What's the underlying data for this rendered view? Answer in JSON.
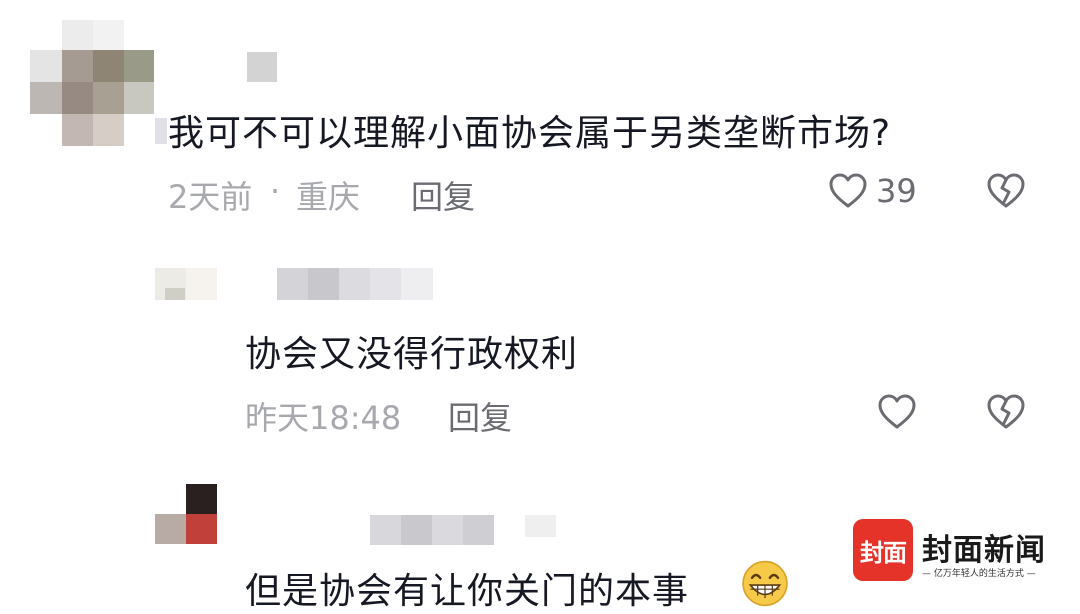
{
  "comments": [
    {
      "text": "我可不可以理解小面协会属于另类垄断市场?",
      "time": "2天前",
      "separator": "·",
      "location": "重庆",
      "reply_label": "回复",
      "like_count": "39"
    },
    {
      "text": "协会又没得行政权利",
      "time": "昨天18:48",
      "reply_label": "回复",
      "like_count": ""
    },
    {
      "text": "但是协会有让你关门的本事",
      "emoji": "grinning-face-emoji"
    }
  ],
  "watermark": {
    "badge_text": "封面",
    "name": "封面新闻",
    "slogan": "— 亿万年轻人的生活方式 —"
  },
  "colors": {
    "text_primary": "#161823",
    "text_meta": "#a8a9ae",
    "brand_red": "#e5332a"
  }
}
